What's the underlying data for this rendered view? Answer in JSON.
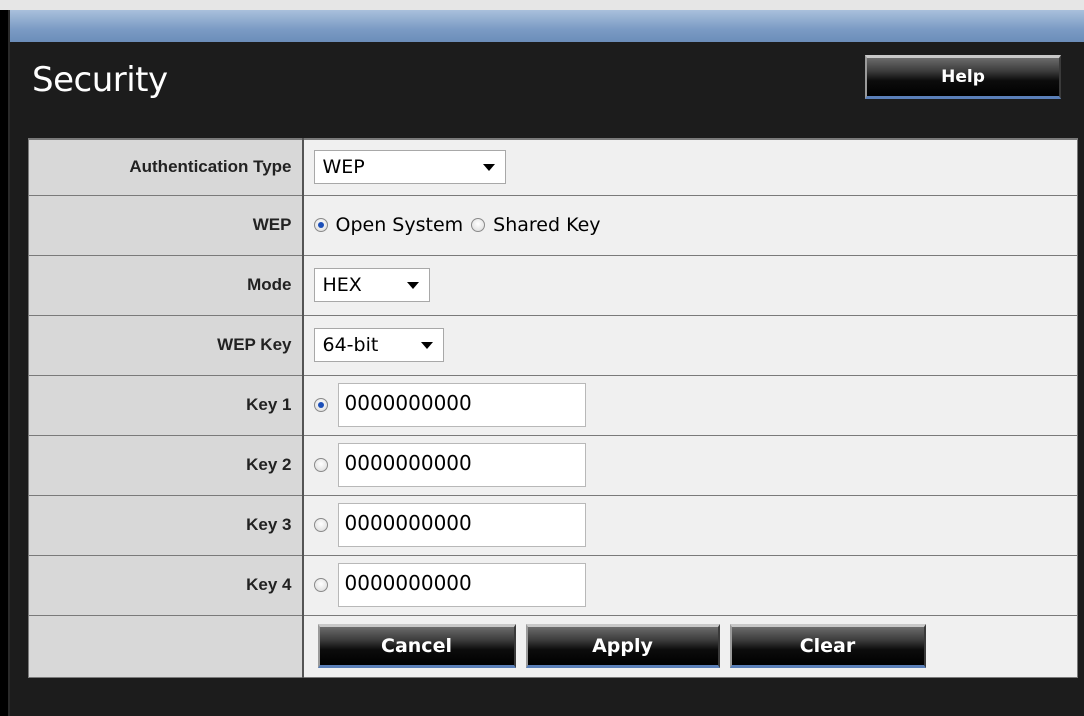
{
  "page": {
    "title": "Security",
    "help_label": "Help"
  },
  "colors": {
    "title_bar": "#7b9bc4",
    "panel_bg": "#1c1c1c",
    "button_accent": "#5a7fb8",
    "radio_selected": "#1c4fb8"
  },
  "form": {
    "authentication_type": {
      "label": "Authentication Type",
      "selected": "WEP"
    },
    "wep": {
      "label": "WEP",
      "options": [
        "Open System",
        "Shared Key"
      ],
      "selected": "Open System"
    },
    "mode": {
      "label": "Mode",
      "selected": "HEX"
    },
    "wep_key": {
      "label": "WEP Key",
      "selected": "64-bit"
    },
    "keys": [
      {
        "label": "Key 1",
        "value": "0000000000",
        "selected": true
      },
      {
        "label": "Key 2",
        "value": "0000000000",
        "selected": false
      },
      {
        "label": "Key 3",
        "value": "0000000000",
        "selected": false
      },
      {
        "label": "Key 4",
        "value": "0000000000",
        "selected": false
      }
    ]
  },
  "actions": {
    "cancel_label": "Cancel",
    "apply_label": "Apply",
    "clear_label": "Clear"
  }
}
